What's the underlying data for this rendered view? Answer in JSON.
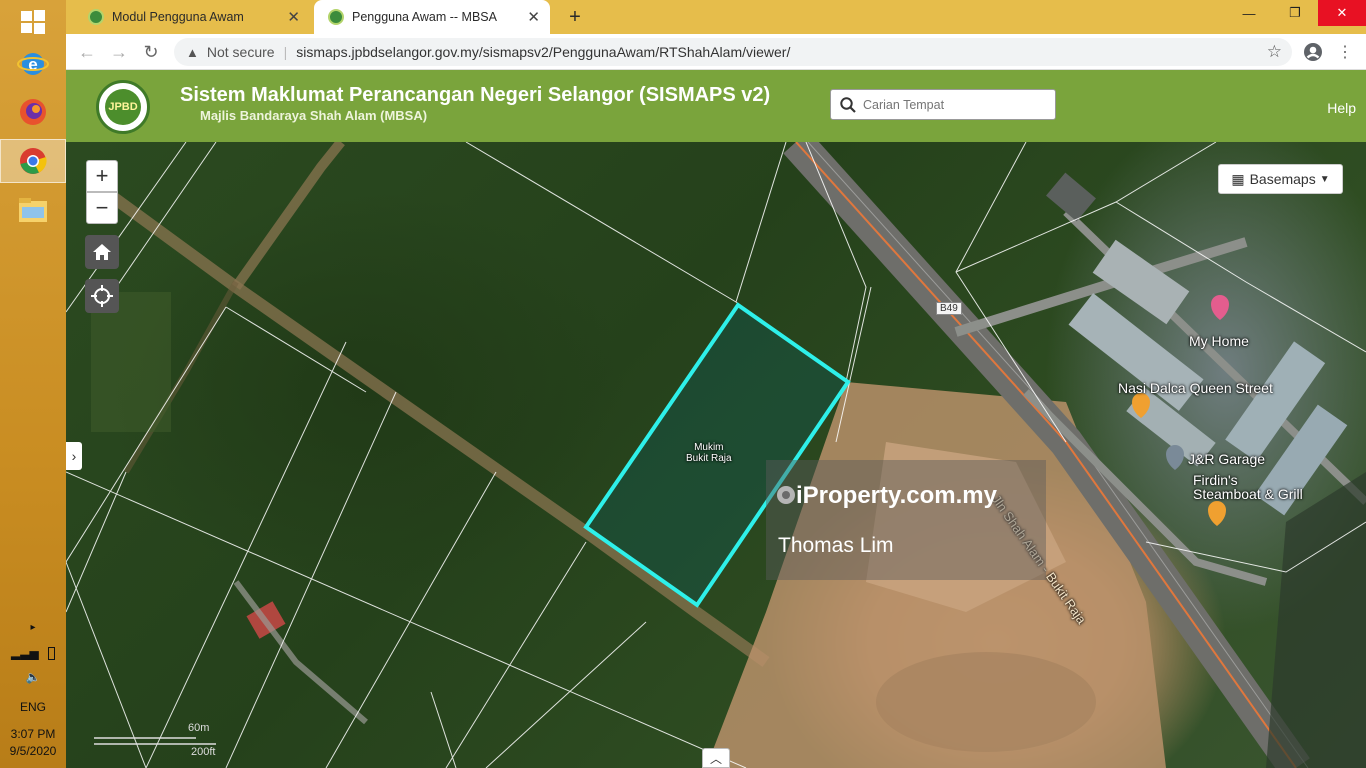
{
  "taskbar": {
    "lang": "ENG",
    "time": "3:07 PM",
    "date": "9/5/2020"
  },
  "tabs": [
    {
      "title": "Modul Pengguna Awam",
      "active": false
    },
    {
      "title": "Pengguna Awam -- MBSA",
      "active": true
    }
  ],
  "addressbar": {
    "security": "Not secure",
    "url": "sismaps.jpbdselangor.gov.my/sismapsv2/PenggunaAwam/RTShahAlam/viewer/"
  },
  "header": {
    "title": "Sistem Maklumat Perancangan Negeri Selangor (SISMAPS v2)",
    "subtitle": "Majlis Bandaraya Shah Alam (MBSA)",
    "logo_text": "JPBD",
    "search_placeholder": "Carian Tempat",
    "help": "Help"
  },
  "map": {
    "basemaps_label": "Basemaps",
    "zoom_in": "+",
    "zoom_out": "−",
    "parcel_label_line1": "Mukim",
    "parcel_label_line2": "Bukit Raja",
    "road_shield": "B49",
    "road_name": "Jln Shah Alam - Bukit Raja",
    "poi": {
      "myhome": "My Home",
      "nasi": "Nasi Dalca Queen Street",
      "garage": "J&R Garage",
      "firdin1": "Firdin's",
      "firdin2": "Steamboat & Grill"
    },
    "scale_m": "60m",
    "scale_ft": "200ft",
    "watermark_brand": "iProperty.com.my",
    "watermark_name": "Thomas Lim",
    "colors": {
      "parcel_outline": "#2ef0ea",
      "header": "#7aa43c"
    }
  }
}
